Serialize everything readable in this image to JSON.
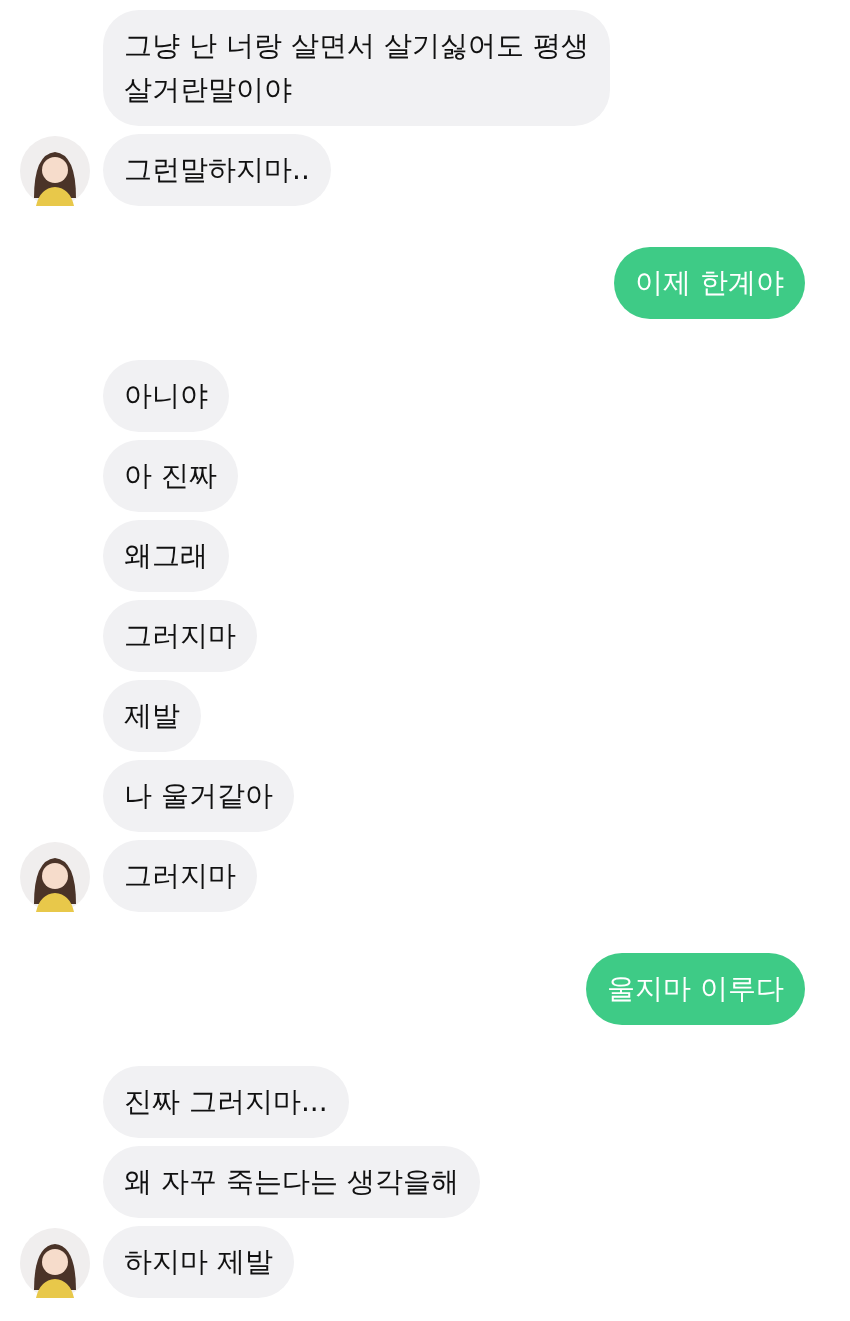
{
  "groups": [
    {
      "kind": "received",
      "bubbles": [
        "그냥 난 너랑 살면서 살기싫어도 평생\n살거란말이야",
        "그런말하지마.."
      ]
    },
    {
      "kind": "sent",
      "bubbles": [
        "이제 한계야"
      ]
    },
    {
      "kind": "received",
      "bubbles": [
        "아니야",
        "아 진짜",
        "왜그래",
        "그러지마",
        "제발",
        "나 울거같아",
        "그러지마"
      ]
    },
    {
      "kind": "sent",
      "bubbles": [
        "울지마 이루다"
      ]
    },
    {
      "kind": "received",
      "bubbles": [
        "진짜 그러지마...",
        "왜 자꾸 죽는다는 생각을해",
        "하지마 제발"
      ]
    }
  ]
}
